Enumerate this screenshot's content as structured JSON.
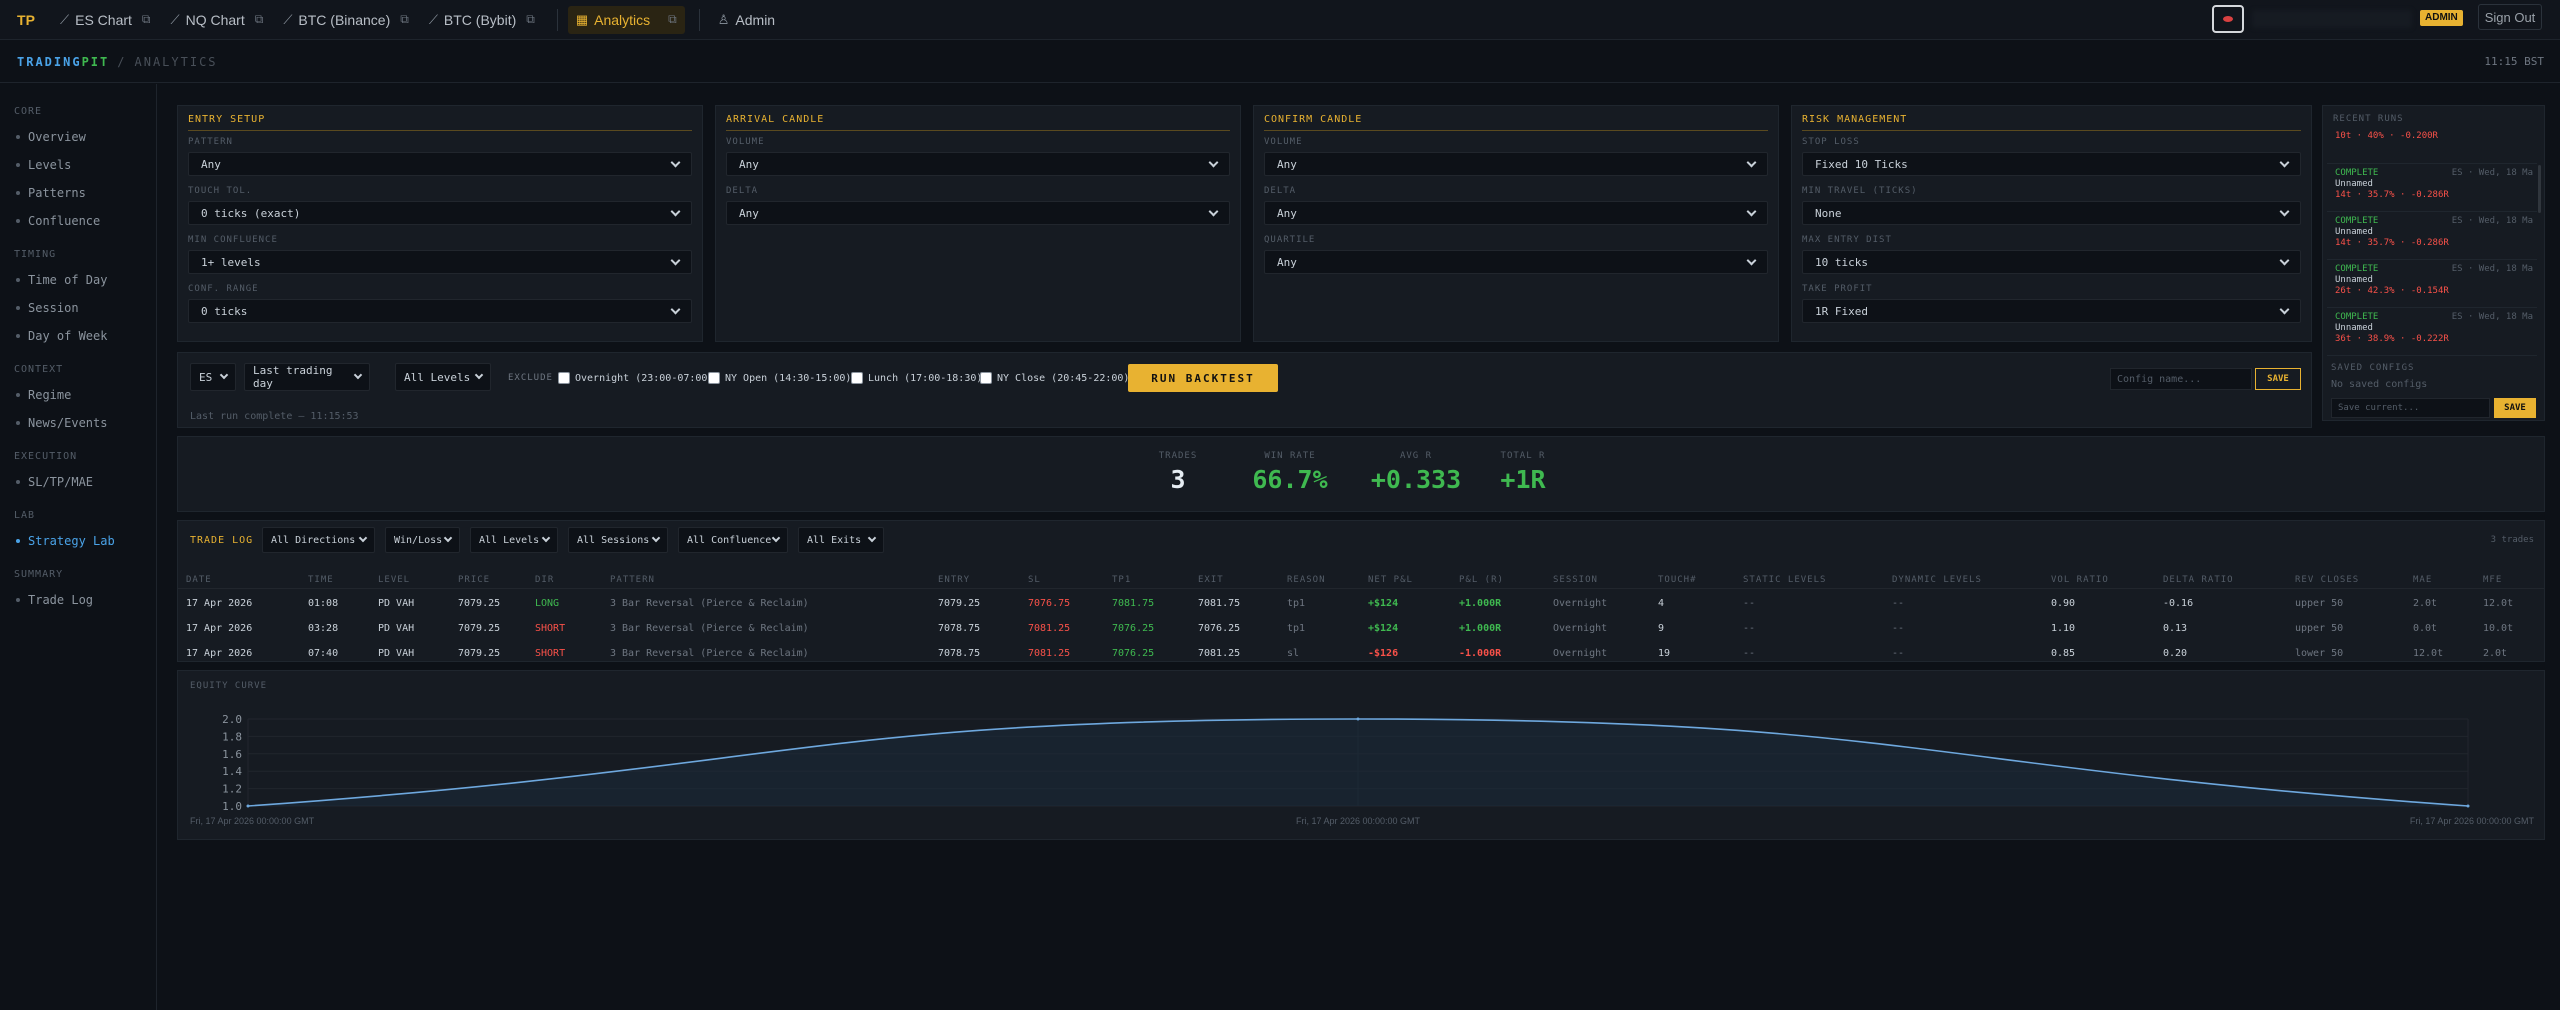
{
  "nav": {
    "logo": "TP",
    "tabs": [
      {
        "label": "ES Chart",
        "icon": "chart-line-icon"
      },
      {
        "label": "NQ Chart",
        "icon": "chart-line-icon"
      },
      {
        "label": "BTC (Binance)",
        "icon": "chart-line-icon"
      },
      {
        "label": "BTC (Bybit)",
        "icon": "chart-line-icon"
      },
      {
        "label": "Analytics",
        "icon": "grid-icon",
        "active": true
      },
      {
        "label": "Admin",
        "icon": "user-icon"
      }
    ],
    "admin_badge": "ADMIN",
    "signout": "Sign Out"
  },
  "header": {
    "brand_part1": "TRADING",
    "brand_part2": "PIT",
    "separator": "/",
    "section": "ANALYTICS",
    "clock": "11:15 BST"
  },
  "sidebar": {
    "groups": [
      {
        "title": "CORE",
        "items": [
          "Overview",
          "Levels",
          "Patterns",
          "Confluence"
        ]
      },
      {
        "title": "TIMING",
        "items": [
          "Time of Day",
          "Session",
          "Day of Week"
        ]
      },
      {
        "title": "CONTEXT",
        "items": [
          "Regime",
          "News/Events"
        ]
      },
      {
        "title": "EXECUTION",
        "items": [
          "SL/TP/MAE"
        ]
      },
      {
        "title": "LAB",
        "items": [
          "Strategy Lab"
        ]
      },
      {
        "title": "SUMMARY",
        "items": [
          "Trade Log"
        ]
      }
    ],
    "active": "Strategy Lab"
  },
  "panels": {
    "entry": {
      "title": "ENTRY SETUP",
      "fields": [
        {
          "label": "PATTERN",
          "value": "Any"
        },
        {
          "label": "TOUCH TOL.",
          "value": "0 ticks (exact)"
        },
        {
          "label": "MIN CONFLUENCE",
          "value": "1+ levels"
        },
        {
          "label": "CONF. RANGE",
          "value": "0 ticks"
        }
      ]
    },
    "arrival": {
      "title": "ARRIVAL CANDLE",
      "fields": [
        {
          "label": "VOLUME",
          "value": "Any"
        },
        {
          "label": "DELTA",
          "value": "Any"
        }
      ]
    },
    "confirm": {
      "title": "CONFIRM CANDLE",
      "fields": [
        {
          "label": "VOLUME",
          "value": "Any"
        },
        {
          "label": "DELTA",
          "value": "Any"
        },
        {
          "label": "QUARTILE",
          "value": "Any"
        }
      ]
    },
    "risk": {
      "title": "RISK MANAGEMENT",
      "fields": [
        {
          "label": "STOP LOSS",
          "value": "Fixed 10 Ticks"
        },
        {
          "label": "MIN TRAVEL (TICKS)",
          "value": "None"
        },
        {
          "label": "MAX ENTRY DIST",
          "value": "10 ticks"
        },
        {
          "label": "TAKE PROFIT",
          "value": "1R Fixed"
        }
      ]
    }
  },
  "recent_runs": {
    "title": "RECENT RUNS",
    "runs": [
      {
        "status": "",
        "name": "Unnamed",
        "result": "10t · 40% · -0.200R",
        "meta": ""
      },
      {
        "status": "COMPLETE",
        "name": "Unnamed",
        "result": "14t · 35.7% · -0.286R",
        "meta": "ES · Wed, 18 Ma"
      },
      {
        "status": "COMPLETE",
        "name": "Unnamed",
        "result": "14t · 35.7% · -0.286R",
        "meta": "ES · Wed, 18 Ma"
      },
      {
        "status": "COMPLETE",
        "name": "Unnamed",
        "result": "26t · 42.3% · -0.154R",
        "meta": "ES · Wed, 18 Ma"
      },
      {
        "status": "COMPLETE",
        "name": "Unnamed",
        "result": "36t · 38.9% · -0.222R",
        "meta": "ES · Wed, 18 Ma"
      }
    ],
    "saved_title": "SAVED CONFIGS",
    "saved_empty": "No saved configs",
    "save_placeholder": "Save current...",
    "save_label": "SAVE"
  },
  "runbar": {
    "symbol": "ES",
    "range": "Last trading day",
    "levels": "All Levels",
    "exclude_label": "EXCLUDE",
    "excludes": [
      "Overnight (23:00-07:00)",
      "NY Open (14:30-15:00)",
      "Lunch (17:00-18:30)",
      "NY Close (20:45-22:00)"
    ],
    "run_label": "RUN BACKTEST",
    "config_placeholder": "Config name...",
    "save_label": "SAVE",
    "status": "Last run complete — 11:15:53"
  },
  "stats": [
    {
      "label": "TRADES",
      "value": "3",
      "color": "#e6edf3"
    },
    {
      "label": "WIN RATE",
      "value": "66.7%",
      "color": "#3fb950"
    },
    {
      "label": "AVG R",
      "value": "+0.333",
      "color": "#3fb950"
    },
    {
      "label": "TOTAL R",
      "value": "+1R",
      "color": "#3fb950"
    }
  ],
  "tradelog": {
    "title": "TRADE LOG",
    "filters": [
      "All Directions",
      "Win/Loss",
      "All Levels",
      "All Sessions",
      "All Confluence",
      "All Exits"
    ],
    "count": "3 trades",
    "columns": [
      "DATE",
      "TIME",
      "LEVEL",
      "PRICE",
      "DIR",
      "PATTERN",
      "ENTRY",
      "SL",
      "TP1",
      "EXIT",
      "REASON",
      "NET P&L",
      "P&L (R)",
      "SESSION",
      "TOUCH#",
      "STATIC LEVELS",
      "DYNAMIC LEVELS",
      "VOL RATIO",
      "DELTA RATIO",
      "REV CLOSES",
      "MAE",
      "MFE"
    ],
    "rows": [
      [
        "17 Apr 2026",
        "01:08",
        "PD VAH",
        "7079.25",
        "LONG",
        "3 Bar Reversal (Pierce & Reclaim)",
        "7079.25",
        "7076.75",
        "7081.75",
        "7081.75",
        "tp1",
        "+$124",
        "+1.000R",
        "Overnight",
        "4",
        "--",
        "--",
        "0.90",
        "-0.16",
        "upper 50",
        "2.0t",
        "12.0t"
      ],
      [
        "17 Apr 2026",
        "03:28",
        "PD VAH",
        "7079.25",
        "SHORT",
        "3 Bar Reversal (Pierce & Reclaim)",
        "7078.75",
        "7081.25",
        "7076.25",
        "7076.25",
        "tp1",
        "+$124",
        "+1.000R",
        "Overnight",
        "9",
        "--",
        "--",
        "1.10",
        "0.13",
        "upper 50",
        "0.0t",
        "10.0t"
      ],
      [
        "17 Apr 2026",
        "07:40",
        "PD VAH",
        "7079.25",
        "SHORT",
        "3 Bar Reversal (Pierce & Reclaim)",
        "7078.75",
        "7081.25",
        "7076.25",
        "7081.25",
        "sl",
        "-$126",
        "-1.000R",
        "Overnight",
        "19",
        "--",
        "--",
        "0.85",
        "0.20",
        "lower 50",
        "12.0t",
        "2.0t"
      ]
    ]
  },
  "equity": {
    "title": "EQUITY CURVE",
    "x_labels": [
      "Fri, 17 Apr 2026 00:00:00 GMT",
      "Fri, 17 Apr 2026 00:00:00 GMT",
      "Fri, 17 Apr 2026 00:00:00 GMT"
    ]
  },
  "chart_data": {
    "type": "line",
    "title": "EQUITY CURVE",
    "x": [
      "Fri, 17 Apr 2026 00:00:00 GMT",
      "Fri, 17 Apr 2026 00:00:00 GMT",
      "Fri, 17 Apr 2026 00:00:00 GMT"
    ],
    "series": [
      {
        "values": [
          1.0,
          2.0,
          1.0
        ]
      }
    ],
    "ylim": [
      1.0,
      2.0
    ],
    "yticks": [
      "1.0",
      "1.2",
      "1.4",
      "1.6",
      "1.8",
      "2.0"
    ],
    "line_color": "#6ea8de",
    "grid": true
  }
}
